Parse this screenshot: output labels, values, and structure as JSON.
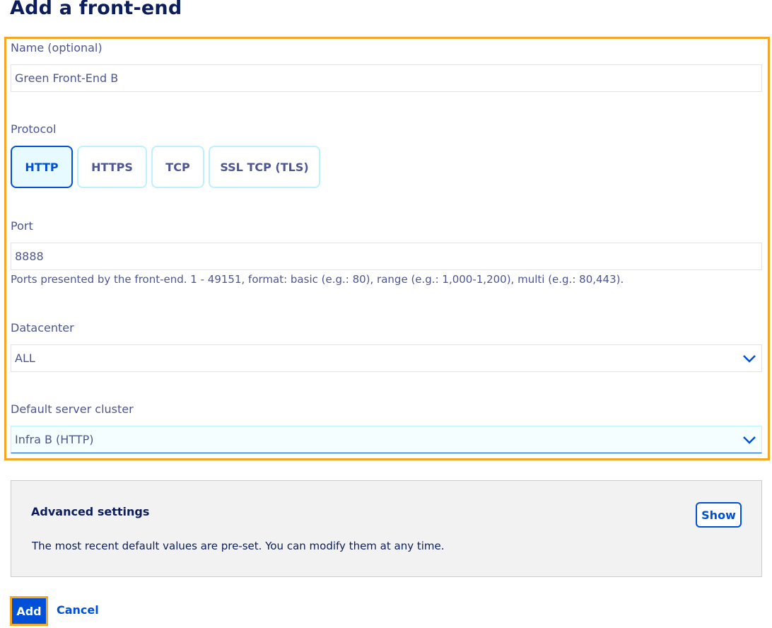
{
  "page": {
    "title": "Add a front-end"
  },
  "form": {
    "name": {
      "label": "Name (optional)",
      "value": "Green Front-End B"
    },
    "protocol": {
      "label": "Protocol",
      "options": [
        "HTTP",
        "HTTPS",
        "TCP",
        "SSL TCP (TLS)"
      ],
      "selected": "HTTP"
    },
    "port": {
      "label": "Port",
      "value": "8888",
      "help": "Ports presented by the front-end. 1 - 49151, format: basic (e.g.: 80), range (e.g.: 1,000-1,200), multi (e.g.: 80,443)."
    },
    "datacenter": {
      "label": "Datacenter",
      "value": "ALL"
    },
    "cluster": {
      "label": "Default server cluster",
      "value": "Infra B (HTTP)"
    }
  },
  "advanced": {
    "title": "Advanced settings",
    "description": "The most recent default values are pre-set. You can modify them at any time.",
    "show_label": "Show"
  },
  "actions": {
    "add_label": "Add",
    "cancel_label": "Cancel"
  },
  "colors": {
    "accent": "#0050d7",
    "highlight": "#f5a623",
    "title": "#0b1e5b",
    "text": "#4d5693",
    "field_border": "#bef1ff"
  }
}
